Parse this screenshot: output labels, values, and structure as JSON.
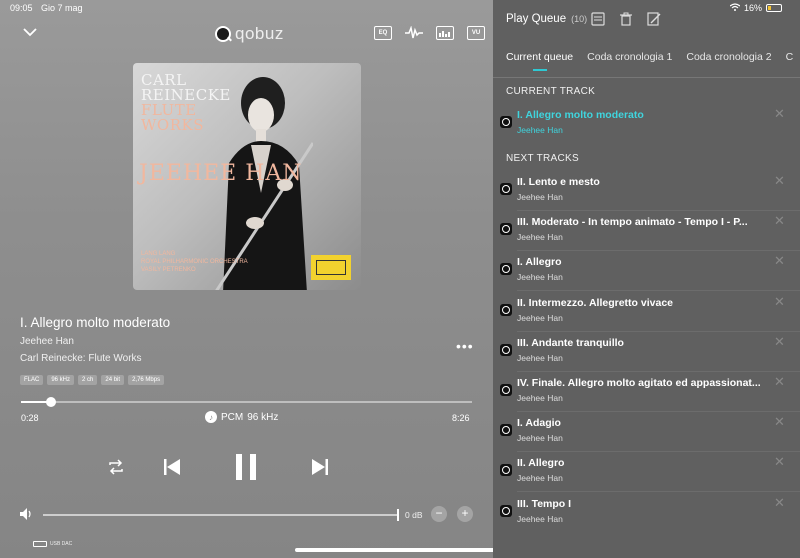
{
  "status": {
    "time": "09:05",
    "date": "Gio 7 mag",
    "battery": "16%"
  },
  "player": {
    "brand": "qobuz",
    "top_icons": [
      "EQ",
      "waveform",
      "spectrum",
      "VU"
    ],
    "album_art": {
      "title_line1": "CARL",
      "title_line2": "REINECKE",
      "title_line3": "FLUTE",
      "title_line4": "WORKS",
      "artist": "JEEHEE HAN",
      "credits": [
        "LANG LANG",
        "ROYAL PHILHARMONIC ORCHESTRA",
        "VASILY PETRENKO"
      ]
    },
    "track_title": "I. Allegro molto moderato",
    "artist": "Jeehee Han",
    "album": "Carl Reinecke: Flute Works",
    "badges": [
      "FLAC",
      "96 kHz",
      "2 ch",
      "24 bit",
      "2,76 Mbps"
    ],
    "progress": 0.066,
    "elapsed": "0:28",
    "total": "8:26",
    "format": "PCM",
    "sample_rate": "96 kHz",
    "volume": 1.0,
    "volume_db": "0 dB",
    "dac_label": "USB DAC"
  },
  "queue": {
    "title": "Play Queue",
    "count": "(10)",
    "tabs": [
      "Current queue",
      "Coda cronologia 1",
      "Coda cronologia 2",
      "C"
    ],
    "current_label": "CURRENT TRACK",
    "next_label": "NEXT TRACKS",
    "current": {
      "title": "I. Allegro molto moderato",
      "artist": "Jeehee Han"
    },
    "next": [
      {
        "title": "II. Lento e mesto",
        "artist": "Jeehee Han"
      },
      {
        "title": "III. Moderato - In tempo animato - Tempo I - P...",
        "artist": "Jeehee Han"
      },
      {
        "title": "I. Allegro",
        "artist": "Jeehee Han"
      },
      {
        "title": "II. Intermezzo. Allegretto vivace",
        "artist": "Jeehee Han"
      },
      {
        "title": "III. Andante tranquillo",
        "artist": "Jeehee Han"
      },
      {
        "title": "IV. Finale. Allegro molto agitato ed appassionat...",
        "artist": "Jeehee Han"
      },
      {
        "title": "I. Adagio",
        "artist": "Jeehee Han"
      },
      {
        "title": "II. Allegro",
        "artist": "Jeehee Han"
      },
      {
        "title": "III. Tempo I",
        "artist": "Jeehee Han"
      }
    ]
  },
  "colors": {
    "accent": "#3fd5de",
    "panel": "#606060",
    "player_bg": "#8e8e8e"
  }
}
